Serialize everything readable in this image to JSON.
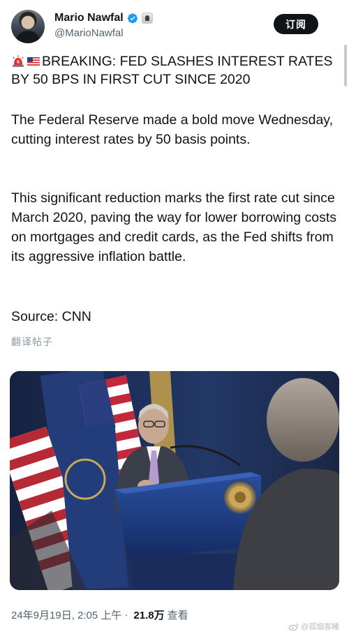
{
  "author": {
    "display_name": "Mario Nawfal",
    "handle": "@MarioNawfal",
    "avatar_icon": "profile-photo",
    "verified_icon": "verified-badge-icon",
    "affiliate_icon": "affiliate-badge-icon"
  },
  "actions": {
    "subscribe_label": "订阅"
  },
  "post": {
    "headline": "BREAKING: FED SLASHES INTEREST RATES BY 50 BPS IN FIRST CUT SINCE 2020",
    "headline_emojis": [
      "siren-emoji",
      "us-flag-emoji"
    ],
    "paragraph_1": "The Federal Reserve made a bold move Wednesday, cutting interest rates by 50 basis points.",
    "paragraph_2": "This significant reduction marks the first rate cut since March 2020, paving the way for lower borrowing costs on mortgages and credit cards, as the Fed shifts from its aggressive inflation battle.",
    "source": "Source: CNN",
    "translate_label": "翻译帖子"
  },
  "meta": {
    "timestamp": "24年9月19日, 2:05 上午",
    "separator": "·",
    "views_count": "21.8万",
    "views_label": "查看"
  },
  "watermark": {
    "text": "@孤烟客睡"
  },
  "colors": {
    "text": "#0f1419",
    "secondary": "#536471",
    "verified": "#1d9bf0",
    "button_bg": "#0f1419"
  }
}
